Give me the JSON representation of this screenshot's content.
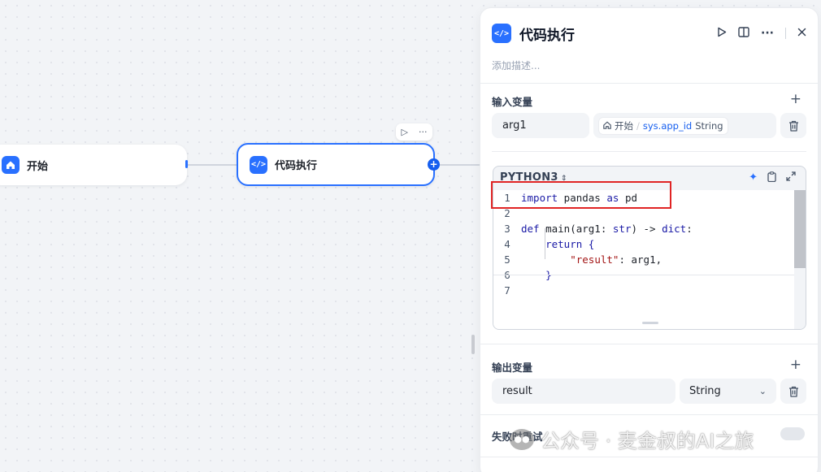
{
  "canvas": {
    "start_node": {
      "label": "开始",
      "icon": "home-icon"
    },
    "code_node": {
      "label": "代码执行",
      "icon": "code-icon"
    },
    "node_toolbar": {
      "run_icon": "play-icon",
      "more_icon": "more-icon"
    },
    "add_handle": "+"
  },
  "panel": {
    "title": "代码执行",
    "icon": "code-icon",
    "description_placeholder": "添加描述...",
    "actions": [
      "play-icon",
      "split-view-icon",
      "more-icon",
      "close-icon"
    ],
    "input_section": {
      "label": "输入变量",
      "variables": [
        {
          "name": "arg1",
          "ref_node": "开始",
          "ref_var": "sys.app_id",
          "ref_type": "String"
        }
      ]
    },
    "code_section": {
      "language": "PYTHON3",
      "lines": [
        {
          "n": "1",
          "tokens": [
            {
              "t": "import",
              "k": "kw"
            },
            {
              "t": " pandas ",
              "k": "plain"
            },
            {
              "t": "as",
              "k": "kw"
            },
            {
              "t": " pd",
              "k": "plain"
            }
          ]
        },
        {
          "n": "2",
          "tokens": []
        },
        {
          "n": "3",
          "tokens": [
            {
              "t": "def",
              "k": "kw"
            },
            {
              "t": " main(arg1: ",
              "k": "plain"
            },
            {
              "t": "str",
              "k": "kw"
            },
            {
              "t": ") -> ",
              "k": "plain"
            },
            {
              "t": "dict",
              "k": "kw"
            },
            {
              "t": ":",
              "k": "plain"
            }
          ]
        },
        {
          "n": "4",
          "tokens": [
            {
              "t": "    ",
              "k": "plain"
            },
            {
              "t": "return",
              "k": "kw"
            },
            {
              "t": " {",
              "k": "kw"
            }
          ]
        },
        {
          "n": "5",
          "tokens": [
            {
              "t": "        ",
              "k": "plain"
            },
            {
              "t": "\"result\"",
              "k": "str"
            },
            {
              "t": ": arg1,",
              "k": "plain"
            }
          ]
        },
        {
          "n": "6",
          "tokens": [
            {
              "t": "    ",
              "k": "plain"
            },
            {
              "t": "}",
              "k": "kw"
            }
          ]
        },
        {
          "n": "7",
          "tokens": []
        }
      ]
    },
    "output_section": {
      "label": "输出变量",
      "variables": [
        {
          "name": "result",
          "type": "String"
        }
      ]
    },
    "retry_section": {
      "label": "失败时重试"
    }
  },
  "watermark": {
    "text": "公众号 · 麦金叔的AI之旅"
  },
  "colors": {
    "accent": "#2970ff",
    "highlight_border": "#e02424"
  }
}
